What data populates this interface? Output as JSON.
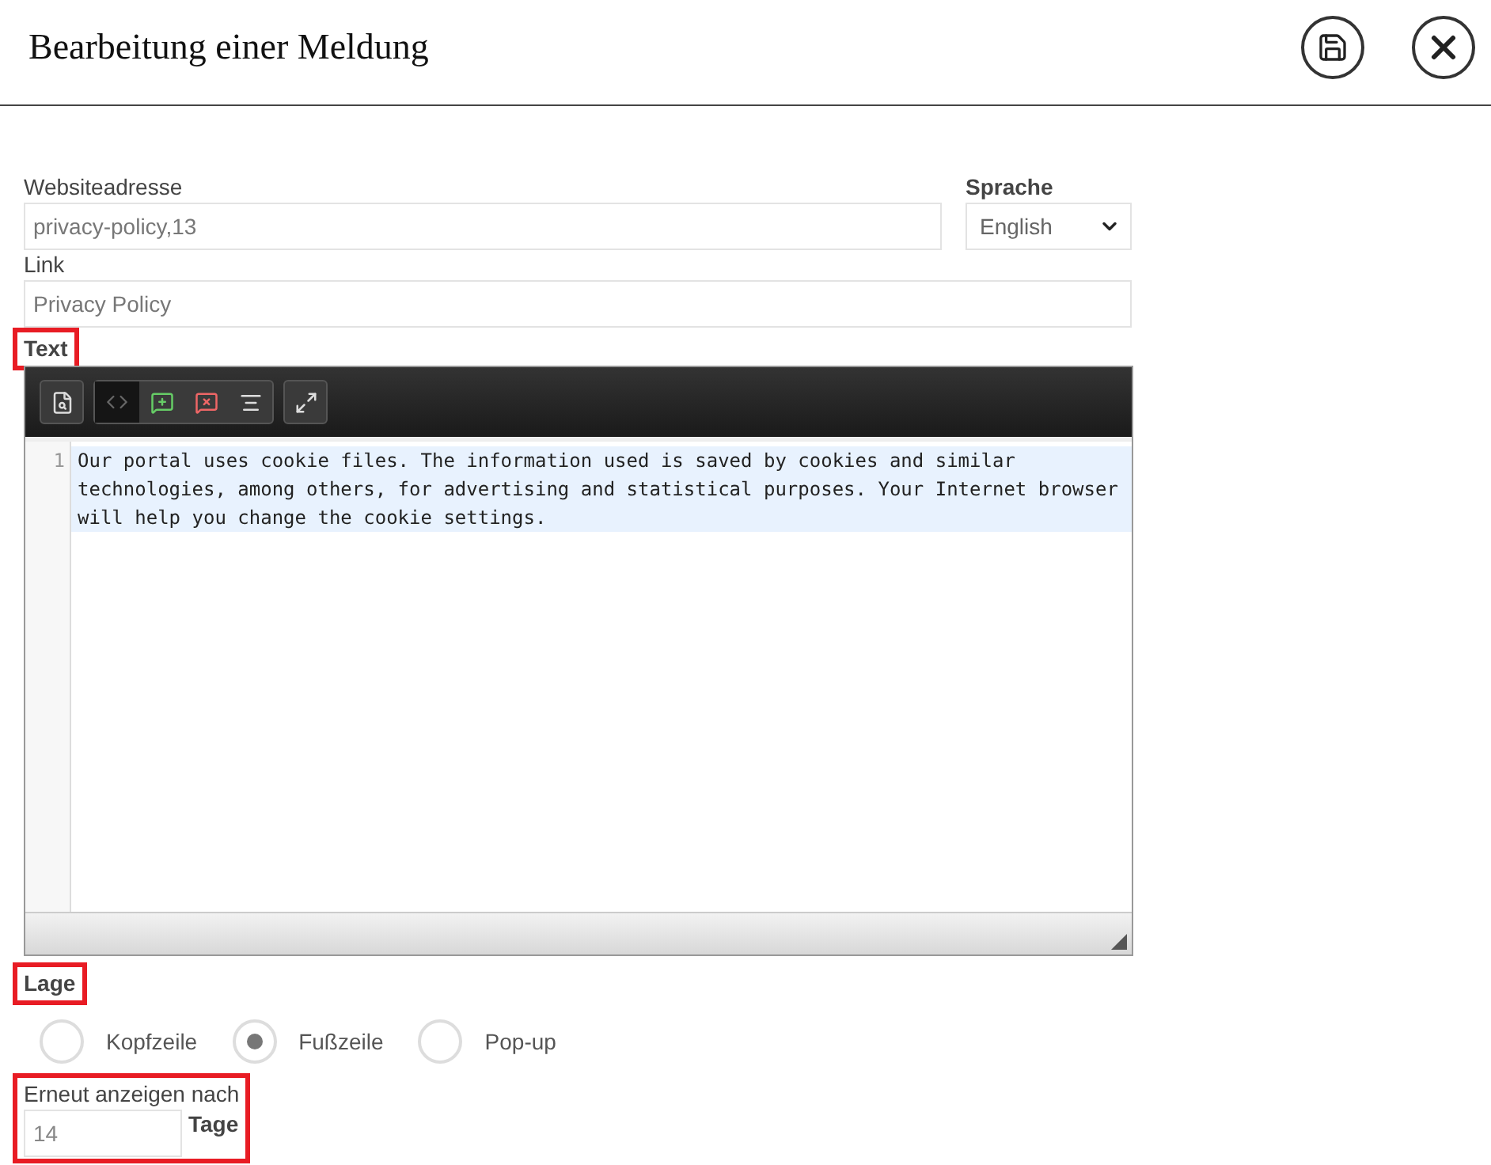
{
  "header": {
    "title": "Bearbeitung einer Meldung"
  },
  "website": {
    "label": "Websiteadresse",
    "value": "privacy-policy,13"
  },
  "language": {
    "label": "Sprache",
    "value": "English"
  },
  "link": {
    "label": "Link",
    "value": "Privacy Policy"
  },
  "text_editor": {
    "label": "Text",
    "highlighted": true,
    "lines": [
      {
        "number": "1",
        "text": "Our portal uses cookie files. The information used is saved by cookies and similar technologies, among others, for advertising and statistical purposes. Your Internet browser will help you change the cookie settings."
      }
    ]
  },
  "position": {
    "label": "Lage",
    "highlighted": true,
    "options": [
      {
        "label": "Kopfzeile",
        "selected": false
      },
      {
        "label": "Fußzeile",
        "selected": true
      },
      {
        "label": "Pop-up",
        "selected": false
      }
    ]
  },
  "repeat": {
    "label": "Erneut anzeigen nach",
    "highlighted": true,
    "value": "14",
    "unit": "Tage"
  }
}
